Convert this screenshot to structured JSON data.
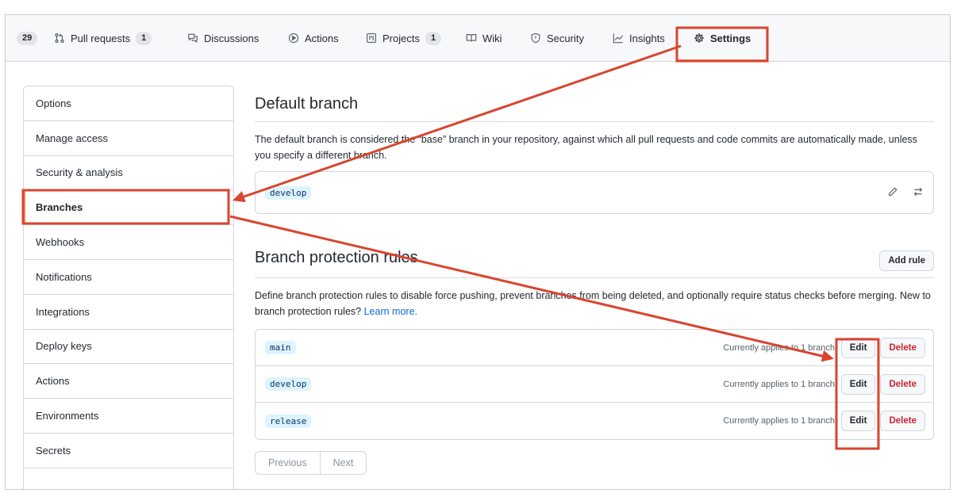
{
  "nav": {
    "issues_count": "29",
    "tabs": [
      {
        "label": "Pull requests",
        "count": "1",
        "icon": "pull-request-icon"
      },
      {
        "label": "Discussions",
        "count": "",
        "icon": "discussion-icon"
      },
      {
        "label": "Actions",
        "count": "",
        "icon": "play-icon"
      },
      {
        "label": "Projects",
        "count": "1",
        "icon": "project-icon"
      },
      {
        "label": "Wiki",
        "count": "",
        "icon": "book-icon"
      },
      {
        "label": "Security",
        "count": "",
        "icon": "shield-icon"
      },
      {
        "label": "Insights",
        "count": "",
        "icon": "graph-icon"
      },
      {
        "label": "Settings",
        "count": "",
        "icon": "gear-icon"
      }
    ]
  },
  "sidebar": {
    "items": [
      {
        "label": "Options"
      },
      {
        "label": "Manage access"
      },
      {
        "label": "Security & analysis"
      },
      {
        "label": "Branches"
      },
      {
        "label": "Webhooks"
      },
      {
        "label": "Notifications"
      },
      {
        "label": "Integrations"
      },
      {
        "label": "Deploy keys"
      },
      {
        "label": "Actions"
      },
      {
        "label": "Environments"
      },
      {
        "label": "Secrets"
      }
    ]
  },
  "default_branch": {
    "title": "Default branch",
    "description": "The default branch is considered the “base” branch in your repository, against which all pull requests and code commits are automatically made, unless you specify a different branch.",
    "branch": "develop"
  },
  "protection": {
    "title": "Branch protection rules",
    "add_rule_label": "Add rule",
    "description": "Define branch protection rules to disable force pushing, prevent branches from being deleted, and optionally require status checks before merging. New to branch protection rules? ",
    "learn_more": "Learn more.",
    "rules": [
      {
        "branch": "main",
        "applies": "Currently applies to 1 branch",
        "edit": "Edit",
        "delete": "Delete"
      },
      {
        "branch": "develop",
        "applies": "Currently applies to 1 branch",
        "edit": "Edit",
        "delete": "Delete"
      },
      {
        "branch": "release",
        "applies": "Currently applies to 1 branch",
        "edit": "Edit",
        "delete": "Delete"
      }
    ],
    "pager": {
      "previous": "Previous",
      "next": "Next"
    }
  },
  "colors": {
    "annotation": "#d9452f",
    "accent_link": "#0969da",
    "danger": "#cf222e"
  }
}
